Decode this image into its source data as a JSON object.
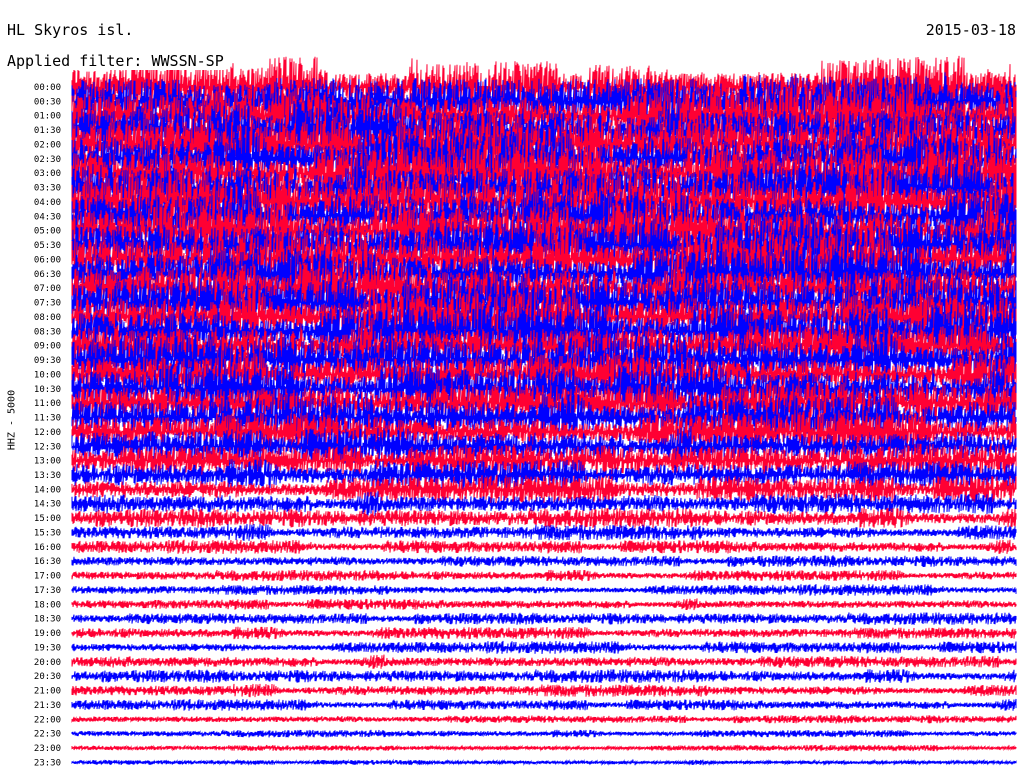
{
  "header": {
    "station": "HL Skyros isl.",
    "date": "2015-03-18",
    "filter": "Applied filter: WWSSN-SP"
  },
  "chart_data": {
    "type": "line",
    "title": "HL Skyros isl.",
    "date": "2015-03-18",
    "filter": "WWSSN-SP",
    "channel_label": "HHZ - 5000",
    "row_labels": [
      "00:00",
      "00:30",
      "01:00",
      "01:30",
      "02:00",
      "02:30",
      "03:00",
      "03:30",
      "04:00",
      "04:30",
      "05:00",
      "05:30",
      "06:00",
      "06:30",
      "07:00",
      "07:30",
      "08:00",
      "08:30",
      "09:00",
      "09:30",
      "10:00",
      "10:30",
      "11:00",
      "11:30",
      "12:00",
      "12:30",
      "13:00",
      "13:30",
      "14:00",
      "14:30",
      "15:00",
      "15:30",
      "16:00",
      "16:30",
      "17:00",
      "17:30",
      "18:00",
      "18:30",
      "19:00",
      "19:30",
      "20:00",
      "20:30",
      "21:00",
      "21:30",
      "22:00",
      "22:30",
      "23:00",
      "23:30"
    ],
    "series_colors": [
      "#ff0033",
      "#0000ff"
    ],
    "relative_amplitude": [
      1.0,
      1.0,
      1.0,
      1.0,
      1.0,
      1.0,
      1.0,
      1.0,
      1.0,
      1.0,
      0.95,
      0.95,
      0.95,
      0.95,
      0.9,
      0.9,
      0.9,
      0.9,
      0.85,
      0.85,
      0.8,
      0.8,
      0.75,
      0.75,
      0.7,
      0.62,
      0.55,
      0.5,
      0.45,
      0.38,
      0.32,
      0.28,
      0.22,
      0.2,
      0.18,
      0.18,
      0.18,
      0.2,
      0.2,
      0.2,
      0.22,
      0.22,
      0.22,
      0.18,
      0.14,
      0.12,
      0.1,
      0.08
    ],
    "grid": false
  }
}
